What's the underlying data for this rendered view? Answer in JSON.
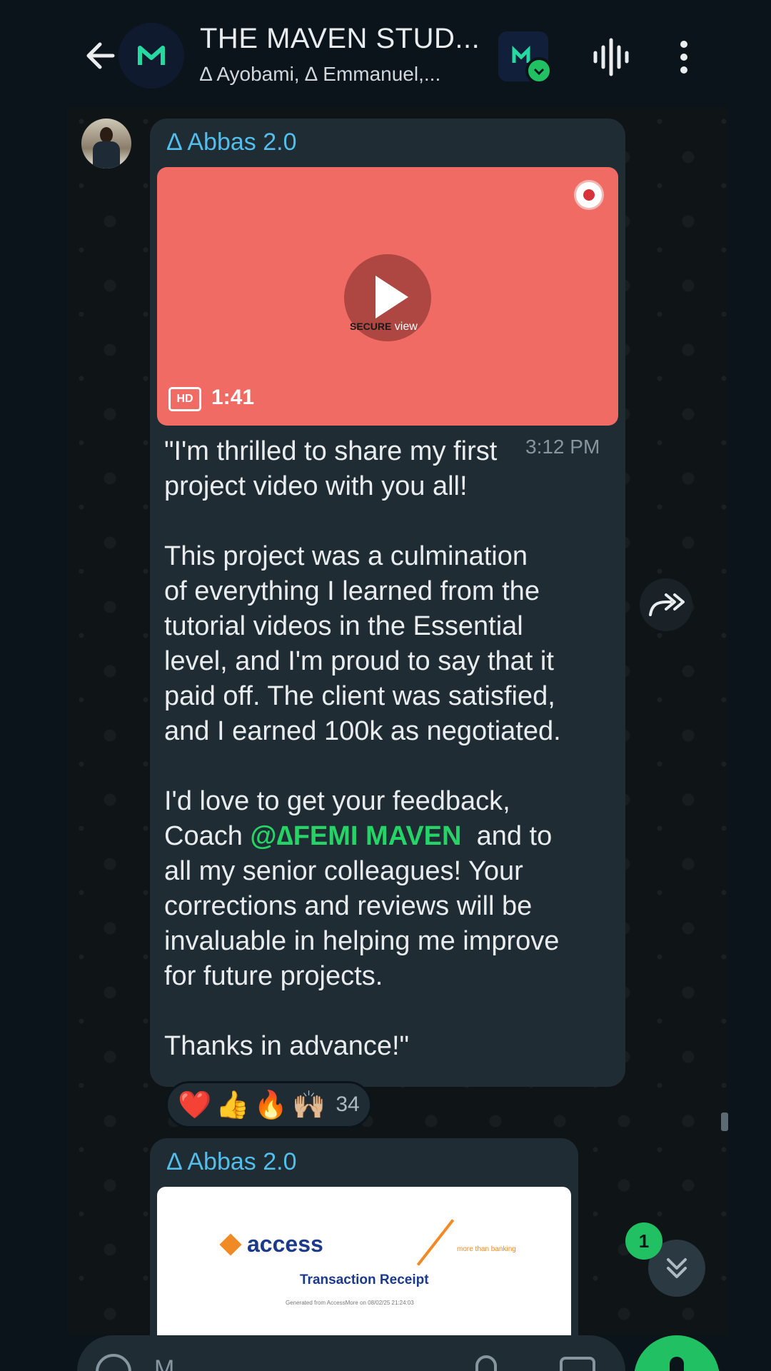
{
  "header": {
    "title": "THE MAVEN STUD...",
    "subtitle": "∆ Ayobami, ∆ Emmanuel,...",
    "group_avatar_letter": "M",
    "icons": [
      "back-arrow-icon",
      "community-icon",
      "voice-chat-icon",
      "more-options-icon"
    ]
  },
  "message1": {
    "sender": "∆ Abbas 2.0",
    "video_duration": "1:41",
    "video_quality": "HD",
    "watermark_bold": "SECURE",
    "watermark_text": " view",
    "time": "3:12 PM",
    "text_part1": "\"I'm thrilled to share my first\nproject video with you all!\n\nThis project was a culmination\nof everything I learned from the\ntutorial videos in the Essential\nlevel, and I'm proud to say that it\npaid off. The client was satisfied,\nand I earned 100k as negotiated.\n\nI'd love to get your feedback,\nCoach ",
    "mention": "@∆FEMI MAVEN",
    "text_part2": "  and to\nall my senior colleagues! Your\ncorrections and reviews will be\ninvaluable in helping me improve\nfor future projects.\n\nThanks in advance!\"",
    "reactions": {
      "emojis": [
        "❤️",
        "👍",
        "🔥",
        "🙌🏼"
      ],
      "count": "34"
    }
  },
  "message2": {
    "sender": "∆ Abbas 2.0",
    "receipt": {
      "brand": "access",
      "tagline": "more than banking",
      "title": "Transaction Receipt",
      "subtitle": "Generated from AccessMore on 08/02/25 21:24:03"
    }
  },
  "unread_count": "1",
  "input": {
    "placeholder": "M"
  },
  "colors": {
    "accent_green": "#21c063",
    "sender_blue": "#53bdeb",
    "bubble": "#202c33",
    "video_bg": "#ef6b63"
  }
}
